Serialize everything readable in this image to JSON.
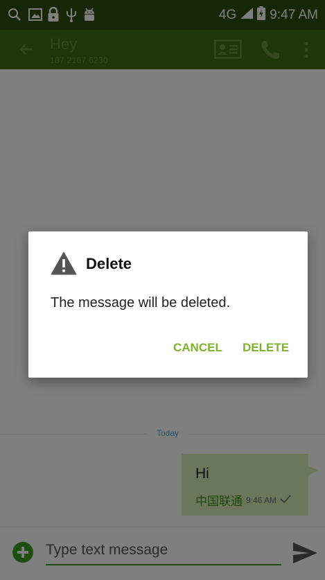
{
  "status_bar": {
    "network": "4G",
    "time": "9:47 AM",
    "icons": [
      "search-icon",
      "image-icon",
      "lock-icon",
      "usb-icon",
      "android-debug-icon",
      "signal-icon",
      "battery-charging-icon"
    ]
  },
  "toolbar": {
    "title": "Hey",
    "subtitle": "187 2167 6230",
    "icons": [
      "back-arrow-icon",
      "contact-card-icon",
      "phone-icon",
      "more-vert-icon"
    ]
  },
  "conversation": {
    "date_label": "Today",
    "messages": [
      {
        "text": "Hi",
        "carrier": "中国联通",
        "time": "9:46 AM",
        "status_icon": "check-icon"
      }
    ]
  },
  "compose": {
    "placeholder": "Type text message",
    "value": "",
    "icons": [
      "add-circle-icon",
      "send-icon"
    ]
  },
  "dialog": {
    "title": "Delete",
    "message": "The message will be deleted.",
    "cancel_label": "CANCEL",
    "delete_label": "DELETE",
    "icon": "warning-icon"
  },
  "colors": {
    "status_bar": "#2b4f0e",
    "toolbar": "#3d6c10",
    "accent": "#7cb327",
    "bubble": "#d6ecb5"
  }
}
